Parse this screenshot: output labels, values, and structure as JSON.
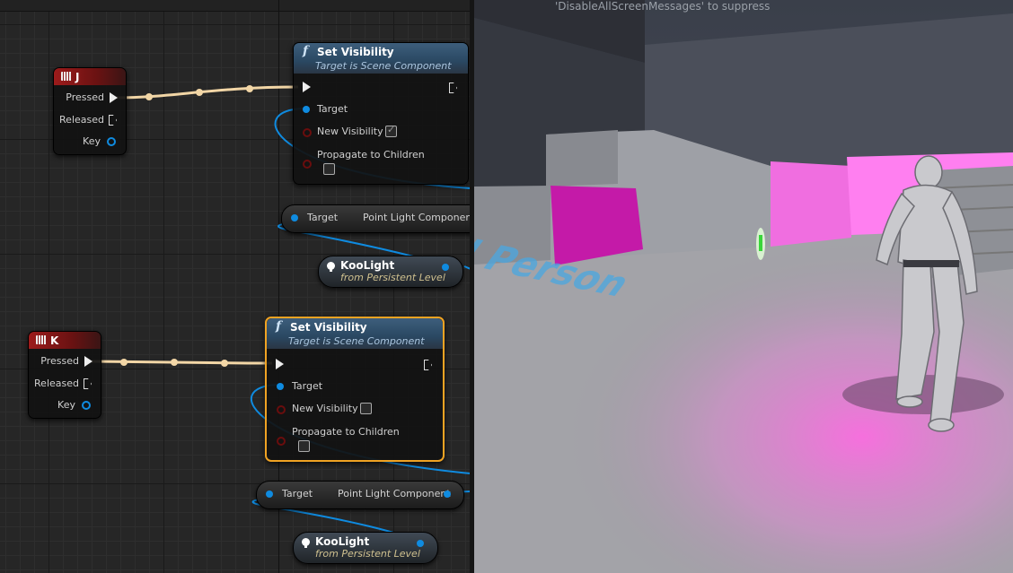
{
  "viewport": {
    "message": "'DisableAllScreenMessages' to suppress",
    "floor_text": "Third Person"
  },
  "nodes": {
    "key_j": {
      "title": "J",
      "pins": [
        "Pressed",
        "Released",
        "Key"
      ]
    },
    "key_k": {
      "title": "K",
      "pins": [
        "Pressed",
        "Released",
        "Key"
      ]
    },
    "set_vis_1": {
      "title": "Set Visibility",
      "subtitle": "Target is Scene Component",
      "pins": {
        "target": "Target",
        "new_visibility": "New Visibility",
        "propagate": "Propagate to Children"
      },
      "new_visibility_checked": true,
      "propagate_checked": false
    },
    "set_vis_2": {
      "title": "Set Visibility",
      "subtitle": "Target is Scene Component",
      "pins": {
        "target": "Target",
        "new_visibility": "New Visibility",
        "propagate": "Propagate to Children"
      },
      "new_visibility_checked": false,
      "propagate_checked": false
    },
    "getter_1": {
      "target": "Target",
      "output": "Point Light Component"
    },
    "getter_2": {
      "target": "Target",
      "output": "Point Light Component"
    },
    "ref_1": {
      "name": "KooLight",
      "level": "from Persistent Level"
    },
    "ref_2": {
      "name": "KooLight",
      "level": "from Persistent Level"
    }
  },
  "icons": {
    "function": "function-icon",
    "keyboard": "keyboard-icon",
    "light": "light-bulb-icon"
  },
  "colors": {
    "exec_wire": "#f2d6a6",
    "object_wire": "#0f8be0",
    "selected_outline": "#f0a323",
    "event_header": "#9d1b1b",
    "function_header": "#3d5e7c",
    "floor_highlight": "#ff4fd8"
  }
}
